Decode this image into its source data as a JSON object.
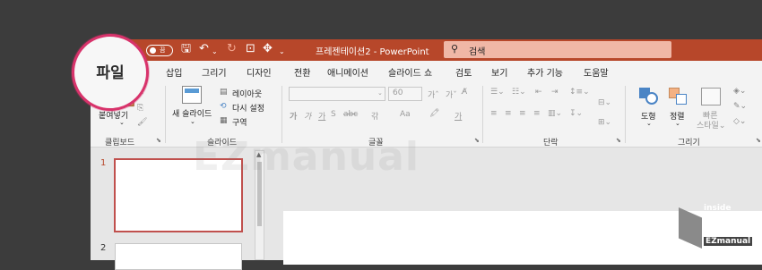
{
  "titlebar": {
    "autosave_label": "끔",
    "doc_title": "프레젠테이션2",
    "app_name": "PowerPoint",
    "search_placeholder": "검색"
  },
  "tabs": [
    "파일",
    "삽입",
    "그리기",
    "디자인",
    "전환",
    "애니메이션",
    "슬라이드 쇼",
    "검토",
    "보기",
    "추가 기능",
    "도움말"
  ],
  "ribbon": {
    "clipboard": {
      "paste": "붙여넣기",
      "group": "클립보드"
    },
    "slides": {
      "new_slide": "새 슬라이드",
      "layout": "레이아웃",
      "reset": "다시 설정",
      "section": "구역",
      "group": "슬라이드"
    },
    "font": {
      "font_size": "60",
      "group": "글꼴",
      "bold": "가",
      "italic": "가",
      "underline": "가",
      "strike": "S",
      "spacing": "갂",
      "case": "Aa",
      "color": "가"
    },
    "paragraph": {
      "group": "단락"
    },
    "drawing": {
      "shapes": "도형",
      "arrange": "정렬",
      "quick_styles": "빠른\n스타일",
      "group": "그리기"
    }
  },
  "slides_panel": {
    "items": [
      {
        "number": "1"
      },
      {
        "number": "2"
      }
    ]
  },
  "highlight": {
    "label": "파일"
  },
  "watermark": {
    "text": "EZmanual"
  },
  "logo": {
    "line1": "inside",
    "line2": "BOX",
    "line3": "EZmanual"
  },
  "colors": {
    "accent": "#b7472a",
    "highlight": "#d8336b"
  }
}
